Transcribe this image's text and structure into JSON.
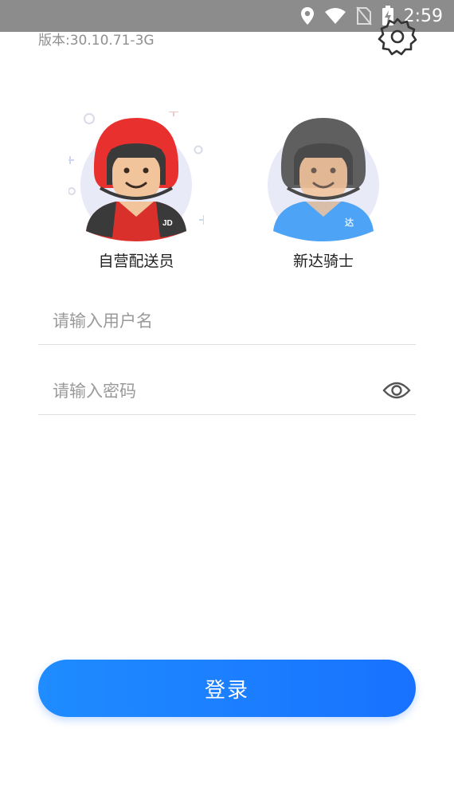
{
  "status_bar": {
    "time": "2:59",
    "icons": [
      "location-icon",
      "wifi-icon",
      "no-sim-icon",
      "battery-charging-icon"
    ]
  },
  "header": {
    "version": "版本:30.10.71-3G",
    "settings_icon": "gear-icon"
  },
  "roles": [
    {
      "label": "自营配送员",
      "helmet_color": "#e8312e",
      "shirt_color": "#d9302b",
      "badge": "JD"
    },
    {
      "label": "新达骑士",
      "helmet_color": "#5f5f5f",
      "shirt_color": "#4da3f5",
      "badge": "达"
    }
  ],
  "form": {
    "username_placeholder": "请输入用户名",
    "password_placeholder": "请输入密码",
    "eye_icon": "eye-icon"
  },
  "login_button": {
    "label": "登录",
    "color": "#1a7cff"
  }
}
